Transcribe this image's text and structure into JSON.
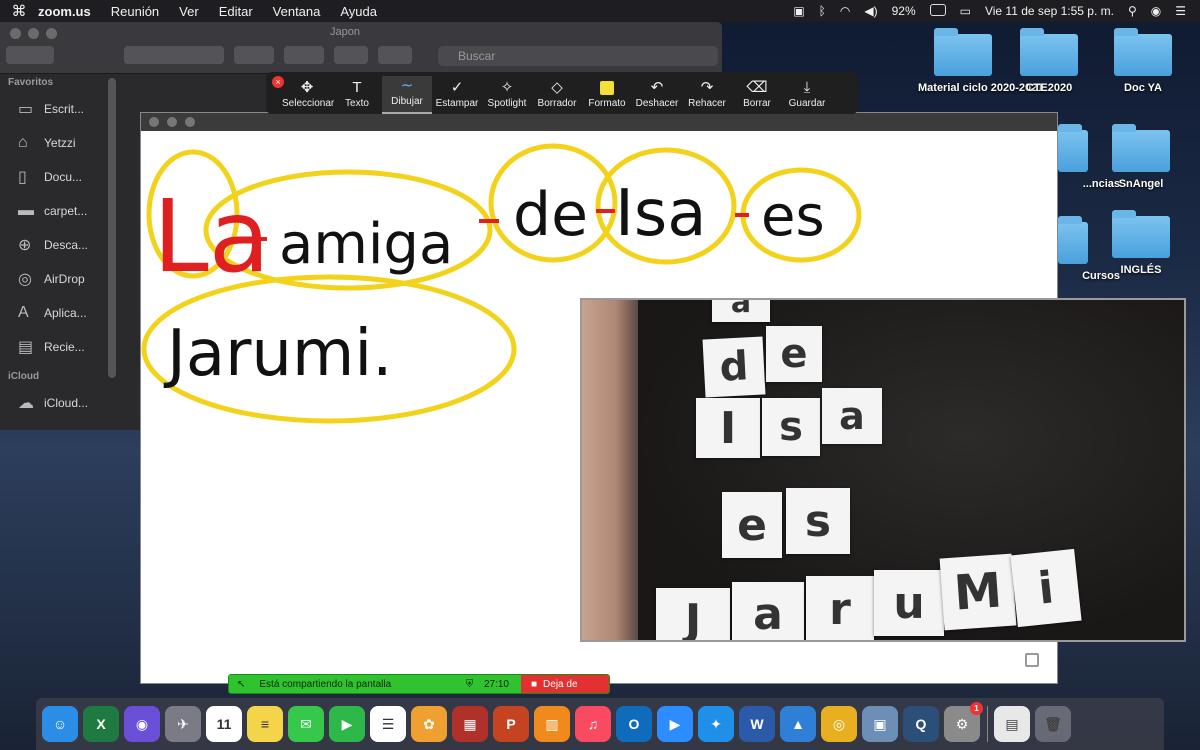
{
  "menubar": {
    "app": "zoom.us",
    "menus": [
      "Reunión",
      "Ver",
      "Editar",
      "Ventana",
      "Ayuda"
    ],
    "battery": "92%",
    "datetime": "Vie 11 de sep  1:55 p. m."
  },
  "desktop": {
    "folders": [
      "Material ciclo 2020-2021",
      "CTE2020",
      "Doc YA",
      "...ncias",
      "SnAngel",
      "Cursos",
      "INGLÉS"
    ]
  },
  "finder": {
    "title": "Japon",
    "search_placeholder": "Buscar",
    "sections": {
      "favorites": "Favoritos",
      "icloud": "iCloud"
    },
    "favorites": [
      "Escrit...",
      "Yetzzi",
      "Docu...",
      "carpet...",
      "Desca...",
      "AirDrop",
      "Aplica...",
      "Recie..."
    ],
    "icloud_items": [
      "iCloud..."
    ]
  },
  "annotation": {
    "tools": [
      "Seleccionar",
      "Texto",
      "Dibujar",
      "Estampar",
      "Spotlight",
      "Borrador",
      "Formato",
      "Deshacer",
      "Rehacer",
      "Borrar",
      "Guardar"
    ],
    "active_tool": "Dibujar",
    "format_color": "#f5e03a"
  },
  "whiteboard": {
    "line1": [
      "La",
      "amiga",
      "de",
      "Isa",
      "es"
    ],
    "line2": [
      "Jarumi."
    ],
    "ink_colors": {
      "black": "#111111",
      "red": "#e02020",
      "yellow": "#f2d21b"
    }
  },
  "camera": {
    "tiles": [
      "a",
      "d",
      "e",
      "I",
      "s",
      "a",
      "e",
      "s",
      "J",
      "a",
      "r",
      "u",
      "M",
      "i"
    ]
  },
  "sharebar": {
    "status": "Está compartiendo la pantalla",
    "elapsed": "27:10",
    "stop": "Deja de"
  },
  "dock": {
    "apps": [
      {
        "name": "finder",
        "color": "#2b8de6",
        "glyph": "☺"
      },
      {
        "name": "excel",
        "color": "#1e7a40",
        "glyph": "X"
      },
      {
        "name": "siri",
        "color": "#6a4fd8",
        "glyph": "◉"
      },
      {
        "name": "launchpad",
        "color": "#7b7b86",
        "glyph": "✈"
      },
      {
        "name": "calendar",
        "color": "#ffffff",
        "glyph": "11"
      },
      {
        "name": "notes",
        "color": "#f4d54a",
        "glyph": "≡"
      },
      {
        "name": "messages",
        "color": "#35c84b",
        "glyph": "✉"
      },
      {
        "name": "facetime",
        "color": "#2fb84a",
        "glyph": "▶"
      },
      {
        "name": "reminders",
        "color": "#ffffff",
        "glyph": "☰"
      },
      {
        "name": "photos",
        "color": "#f0a030",
        "glyph": "✿"
      },
      {
        "name": "photo-booth",
        "color": "#b0302a",
        "glyph": "▦"
      },
      {
        "name": "powerpoint",
        "color": "#c64322",
        "glyph": "P"
      },
      {
        "name": "books",
        "color": "#f08a1c",
        "glyph": "▥"
      },
      {
        "name": "music",
        "color": "#fa4a62",
        "glyph": "♫"
      },
      {
        "name": "outlook",
        "color": "#0f6cbd",
        "glyph": "O"
      },
      {
        "name": "zoom",
        "color": "#2d8cff",
        "glyph": "▶"
      },
      {
        "name": "safari",
        "color": "#1f8fe8",
        "glyph": "✦"
      },
      {
        "name": "word",
        "color": "#2a5aa8",
        "glyph": "W"
      },
      {
        "name": "keynote",
        "color": "#2f7fd6",
        "glyph": "▲"
      },
      {
        "name": "chrome",
        "color": "#e8b020",
        "glyph": "◎"
      },
      {
        "name": "preview",
        "color": "#6e8fb5",
        "glyph": "▣"
      },
      {
        "name": "quicktime",
        "color": "#2c4f7a",
        "glyph": "Q"
      },
      {
        "name": "system-preferences",
        "color": "#8a8a8a",
        "glyph": "⚙",
        "badge": "1"
      }
    ],
    "trash_glyph": "🗑"
  }
}
